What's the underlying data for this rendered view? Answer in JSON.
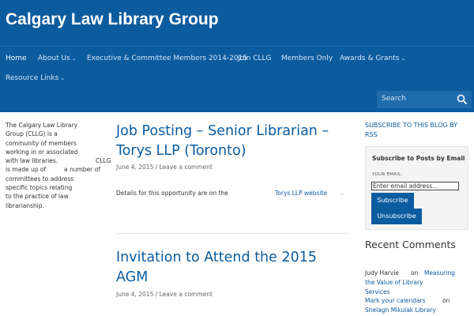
{
  "site": {
    "title": "Calgary Law Library Group"
  },
  "nav": {
    "items": [
      {
        "label": "Home",
        "has_caret": false
      },
      {
        "label": "About Us",
        "has_caret": true
      },
      {
        "label": "Executive & Committee Members 2014-2015",
        "has_caret": false
      },
      {
        "label": "Join CLLG",
        "has_caret": false
      },
      {
        "label": "Members Only",
        "has_caret": false
      },
      {
        "label": "Awards & Grants",
        "has_caret": true
      },
      {
        "label": "Resource Links",
        "has_caret": true
      }
    ]
  },
  "search": {
    "placeholder": "Search",
    "icon": "search-icon"
  },
  "about": {
    "lines": [
      "The Calgary Law Library",
      "Group (CLLG) is a",
      "community of members",
      "working in or associated",
      "with law libraries.",
      "CLLG",
      "is made up of",
      "a number of",
      "committees to address",
      "specific topics relating",
      "to the practice of law",
      "librarianship."
    ]
  },
  "posts": [
    {
      "title_line1": "Job Posting – Senior Librarian –",
      "title_line2": "Torys LLP (Toronto)",
      "date": "June 4, 2015",
      "separator": " / ",
      "comment": "Leave a comment",
      "body": "Details for this opportunity are on the",
      "link": "Torys LLP website",
      "end": "."
    },
    {
      "title_line1": "Invitation to Attend the 2015",
      "title_line2": "AGM",
      "date": "June 4, 2015",
      "separator": " / ",
      "comment": "Leave a comment"
    }
  ],
  "sidebar": {
    "subscribe_blog_line1": "SUBSCRIBE TO THIS BLOG BY",
    "subscribe_blog_line2": "RSS",
    "email": {
      "heading": "Subscribe to Posts by Email",
      "label": "YOUR EMAIL:",
      "value": "Enter email address...",
      "subscribe": "Subscribe",
      "unsubscribe": "Unsubscribe"
    },
    "recent_heading": "Recent Comments",
    "recent": {
      "c1_author": "Judy Harvie",
      "c1_on": "on",
      "c1_post_a": "Measuring",
      "c1_post_b": "the Value of Library",
      "c1_post_c": "Services",
      "c2_author": "Mark your calendars",
      "c2_on": "on",
      "c2_post": "Shelagh Mikulak Library"
    }
  },
  "colors": {
    "brand": "#0b5b9f",
    "nav_text": "#d6e6f5",
    "search_bg": "#1f6cad"
  }
}
